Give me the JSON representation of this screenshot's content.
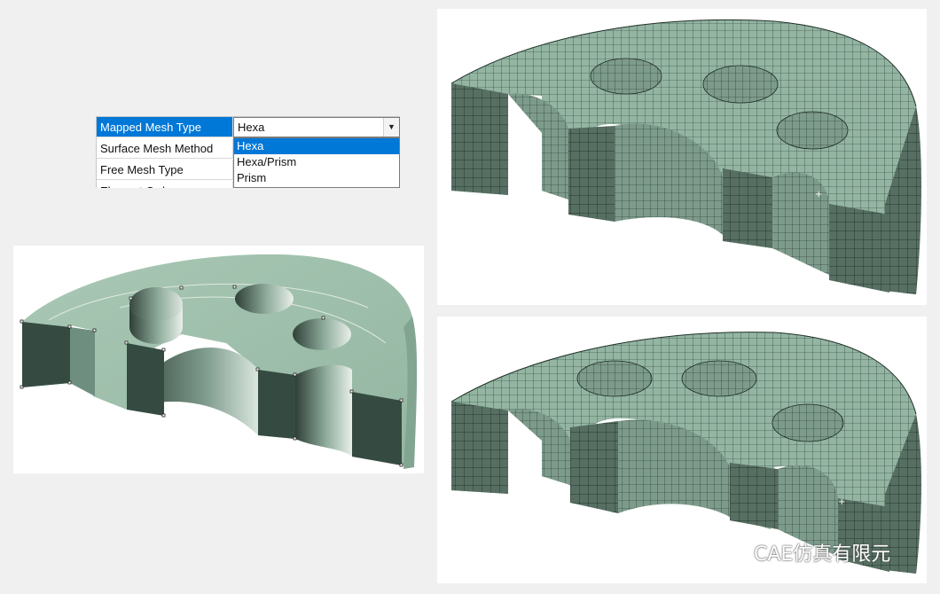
{
  "property_panel": {
    "rows": [
      "Mapped Mesh Type",
      "Surface Mesh Method",
      "Free Mesh Type",
      "Element Order"
    ],
    "selected_row": 0,
    "combo_value": "Hexa",
    "options": [
      "Hexa",
      "Hexa/Prism",
      "Prism"
    ],
    "selected_option": 0
  },
  "colors": {
    "geometry_face": "#9fc0ad",
    "geometry_dark": "#344a40",
    "mesh_face": "#93b5a2",
    "mesh_side": "#7e9f8e",
    "mesh_line": "#1f2f28",
    "selection_blue": "#0078d7"
  },
  "watermark": {
    "text": "CAE仿真有限元"
  }
}
